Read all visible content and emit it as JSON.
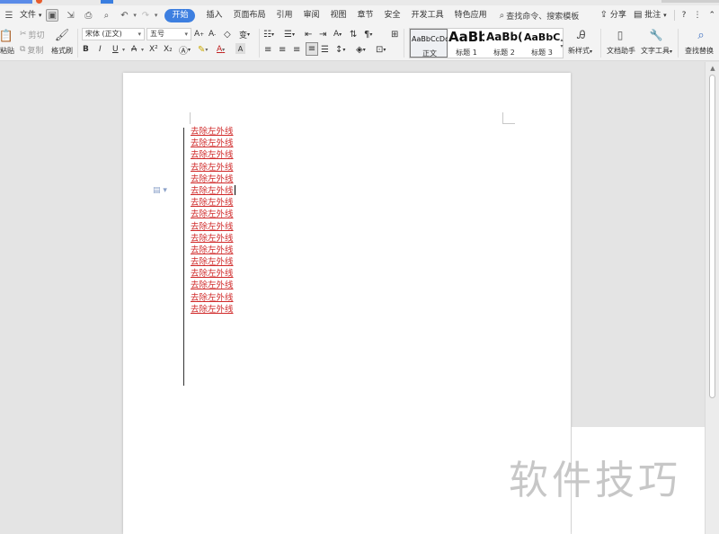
{
  "menubar": {
    "file_label": "文件",
    "tabs": [
      "开始",
      "插入",
      "页面布局",
      "引用",
      "审阅",
      "视图",
      "章节",
      "安全",
      "开发工具",
      "特色应用"
    ],
    "search_label": "查找命令、搜索模板",
    "share_label": "分享",
    "comment_label": "批注",
    "help_label": "?"
  },
  "ribbon": {
    "paste_label": "粘贴",
    "cut_label": "剪切",
    "copy_label": "复制",
    "format_painter_label": "格式刷",
    "font_name": "宋体 (正文)",
    "font_size": "五号",
    "bold": "B",
    "italic": "I",
    "underline": "U",
    "strike": "A",
    "superscript": "X²",
    "subscript": "X₂",
    "styles": [
      {
        "preview": "AaBbCcDd",
        "label": "正文"
      },
      {
        "preview": "AaBb",
        "label": "标题 1"
      },
      {
        "preview": "AaBb(",
        "label": "标题 2"
      },
      {
        "preview": "AaBbC(",
        "label": "标题 3"
      }
    ],
    "new_style_label": "新样式",
    "doc_assistant_label": "文档助手",
    "text_tools_label": "文字工具",
    "find_replace_label": "查找替换"
  },
  "document": {
    "lines": [
      "去除左外线",
      "去除左外线",
      "去除左外线",
      "去除左外线",
      "去除左外线",
      "去除左外线",
      "去除左外线",
      "去除左外线",
      "去除左外线",
      "去除左外线",
      "去除左外线",
      "去除左外线",
      "去除左外线",
      "去除左外线",
      "去除左外线",
      "去除左外线"
    ],
    "text_color": "#d02a2a"
  },
  "watermark": "软件技巧",
  "colors": {
    "accent": "#3d7fe0"
  }
}
